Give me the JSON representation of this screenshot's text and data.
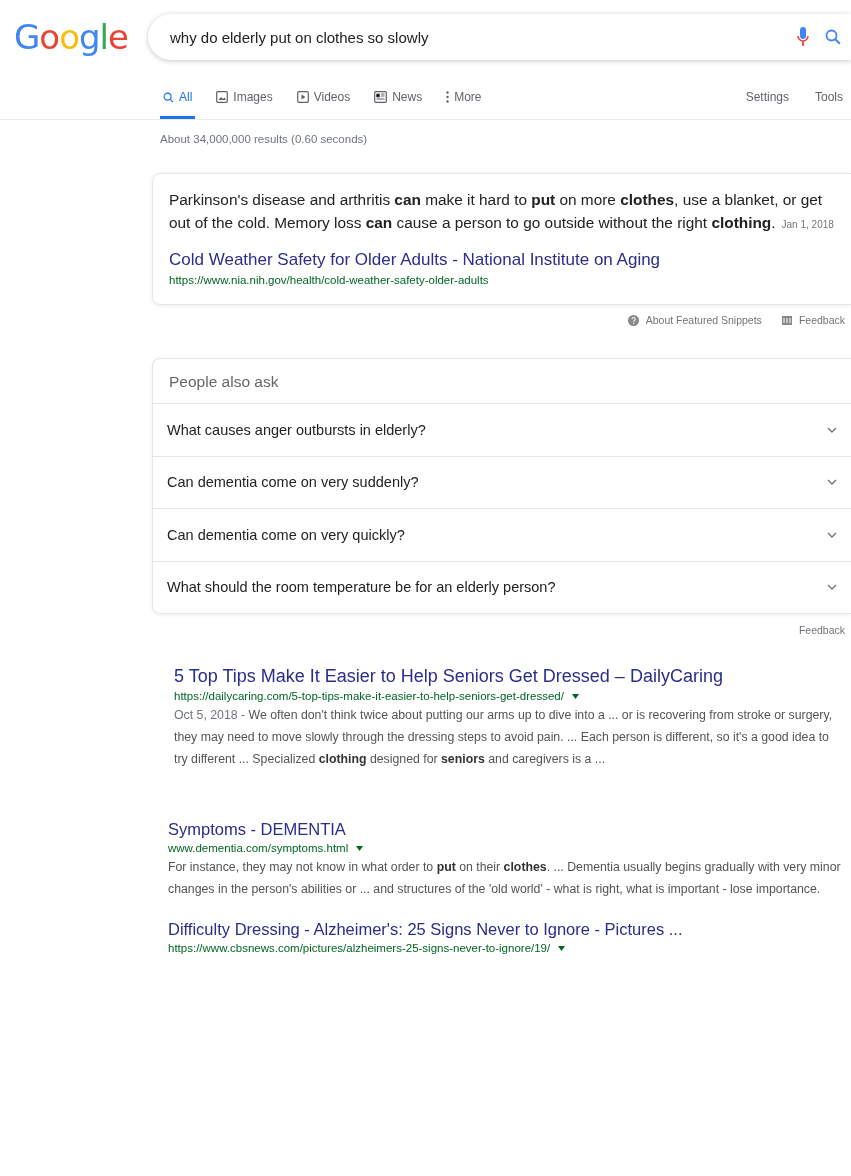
{
  "logo": "Google",
  "search": {
    "value": "why do elderly put on clothes so slowly"
  },
  "tabs": [
    {
      "label": "All",
      "kind": "search",
      "selected": true
    },
    {
      "label": "Images",
      "kind": "image",
      "selected": false
    },
    {
      "label": "Videos",
      "kind": "video",
      "selected": false
    },
    {
      "label": "News",
      "kind": "news",
      "selected": false
    },
    {
      "label": "More",
      "kind": "dots",
      "selected": false
    }
  ],
  "tools": [
    "Settings",
    "Tools"
  ],
  "result_stats": "About 34,000,000 results (0.60 seconds)",
  "featured_snippet": {
    "text": "Parkinson's disease and arthritis **can** make it hard to **put** on more **clothes**, use a blanket, or get out of the cold. Memory loss **can** cause a person to go outside without the right **clothing**.",
    "date": "Jan 1, 2018",
    "title": "Cold Weather Safety for Older Adults - National Institute on Aging",
    "url": "https://www.nia.nih.gov/health/cold-weather-safety-older-adults",
    "footer": [
      "About Featured Snippets",
      "Feedback"
    ]
  },
  "people_also_ask": {
    "heading": "People also ask",
    "questions": [
      {
        "text": "What causes anger outbursts in elderly?",
        "expanded": false
      },
      {
        "text": "Can dementia come on very suddenly?",
        "expanded": false
      },
      {
        "text": "Can dementia come on very quickly?",
        "expanded": false
      },
      {
        "text": "What should the room temperature be for an elderly person?",
        "expanded": false
      }
    ],
    "feedback": "Feedback"
  },
  "results": [
    {
      "title": "5 Top Tips Make It Easier to Help Seniors Get Dressed – DailyCaring",
      "url": "https://dailycaring.com/5-top-tips-make-it-easier-to-help-seniors-get-dressed/",
      "date": "Oct 5, 2018 - ",
      "snippet": "We often don't think twice about putting our arms up to dive into a ... or is recovering from stroke or surgery, they may need to move slowly through the dressing steps to avoid pain. ... Each person is different, so it's a good idea to try different ... Specialized **clothing** designed for **seniors** and caregivers is a ..."
    },
    {
      "title": "Symptoms - DEMENTIA",
      "url": "www.dementia.com/symptoms.html",
      "snippet": "For instance, they may not know in what order to **put** on their **clothes**. ... Dementia usually begins gradually with very minor changes in the person's abilities or ... and structures of the 'old world' - what is right, what is important - lose importance."
    },
    {
      "title": "Difficulty Dressing - Alzheimer's: 25 Signs Never to Ignore - Pictures ...",
      "url": "https://www.cbsnews.com/pictures/alzheimers-25-signs-never-to-ignore/19/"
    }
  ]
}
